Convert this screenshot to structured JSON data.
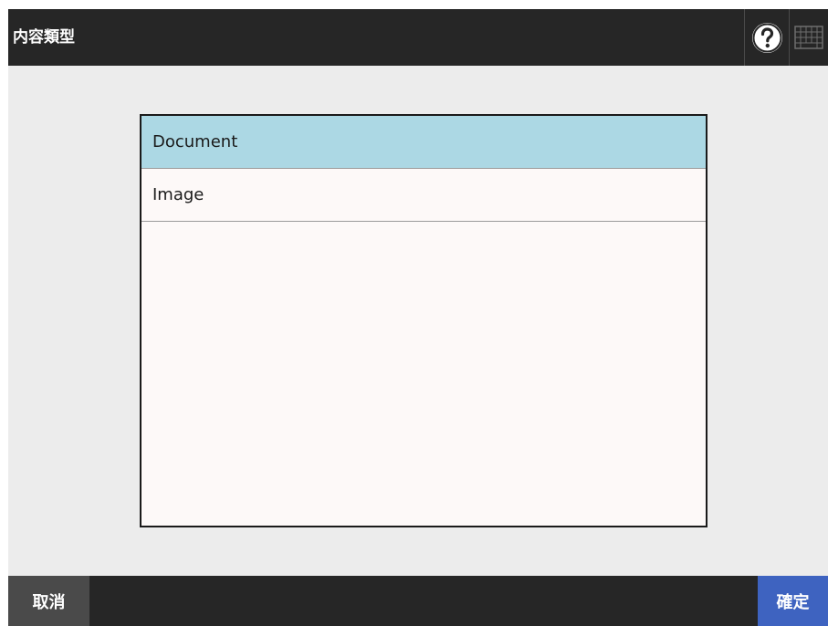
{
  "header": {
    "title": "内容類型",
    "help_icon": "question-mark-icon",
    "keyboard_icon": "keyboard-icon"
  },
  "list": {
    "items": [
      {
        "label": "Document",
        "selected": true
      },
      {
        "label": "Image",
        "selected": false
      }
    ]
  },
  "footer": {
    "cancel_label": "取消",
    "ok_label": "確定"
  },
  "colors": {
    "header_bg": "#262626",
    "content_bg": "#ececec",
    "list_bg": "#fdf9f8",
    "selected_bg": "#acd8e4",
    "cancel_bg": "#4a4a4a",
    "ok_bg": "#3e63c0"
  }
}
